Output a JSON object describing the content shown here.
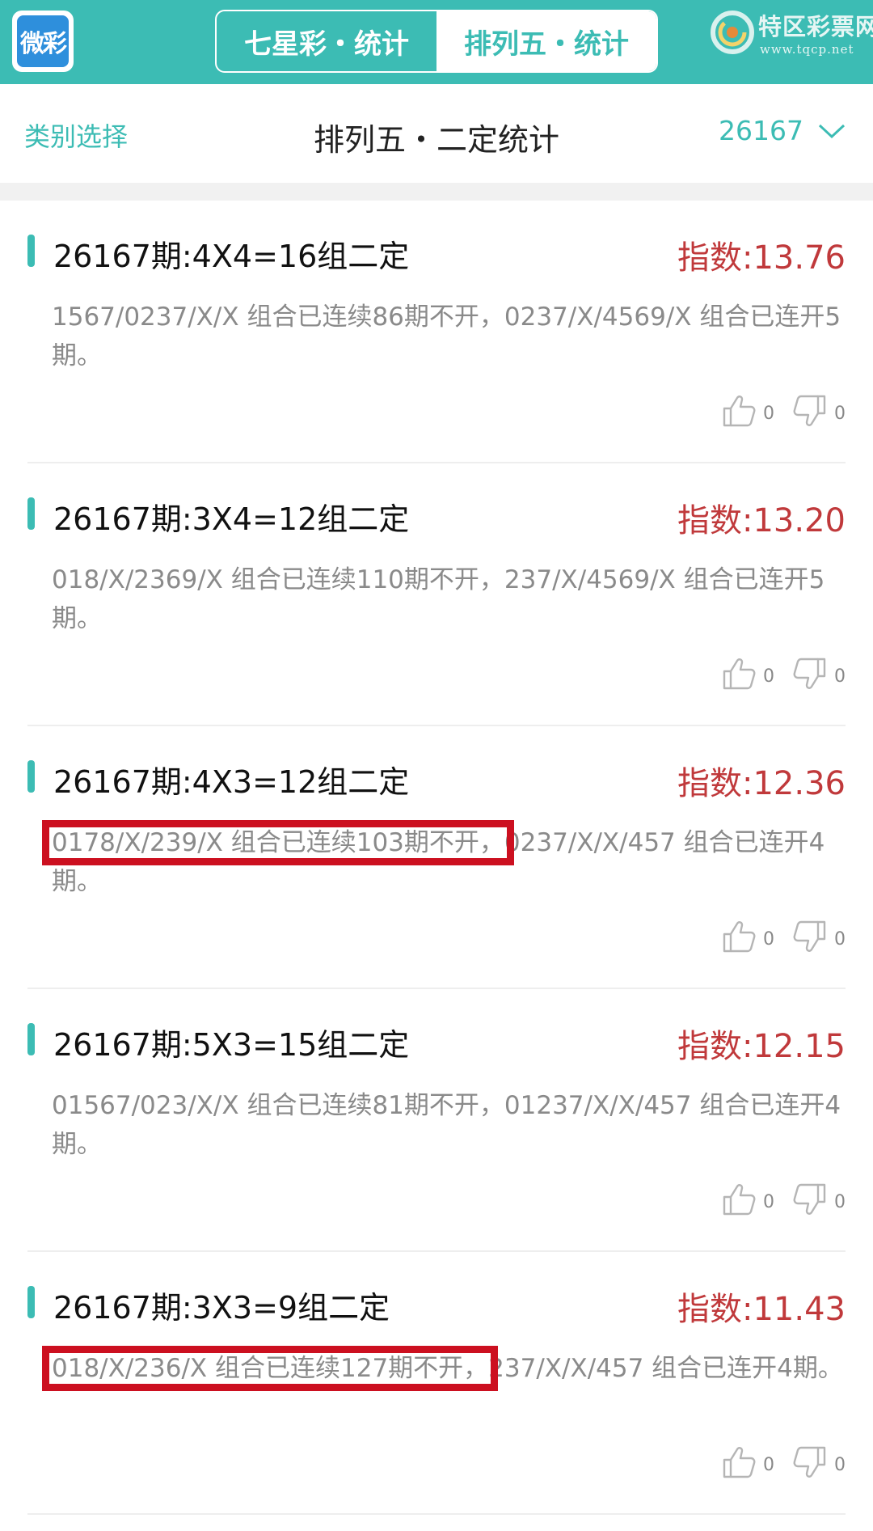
{
  "header": {
    "logo_text": "微彩",
    "tabs": [
      {
        "label": "七星彩・统计",
        "active": false
      },
      {
        "label": "排列五・统计",
        "active": true
      }
    ],
    "brand_name": "特区彩票网",
    "brand_url": "www.tqcp.net"
  },
  "subheader": {
    "category_label": "类别选择",
    "title": "排列五・二定统计",
    "issue": "26167"
  },
  "colors": {
    "accent": "#3cbcb4",
    "index_red": "#c0393b",
    "highlight_red": "#cc1020"
  },
  "cards": [
    {
      "title": "26167期:4X4=16组二定",
      "index": "指数:13.76",
      "desc_a": "1567/0237/X/X 组合已连续86期不开，",
      "desc_b": "0237/X/4569/X 组合已连开5期。",
      "highlighted": false,
      "likes": "0",
      "dislikes": "0"
    },
    {
      "title": "26167期:3X4=12组二定",
      "index": "指数:13.20",
      "desc_a": "018/X/2369/X 组合已连续110期不开，",
      "desc_b": "237/X/4569/X 组合已连开5期。",
      "highlighted": false,
      "likes": "0",
      "dislikes": "0"
    },
    {
      "title": "26167期:4X3=12组二定",
      "index": "指数:12.36",
      "desc_a": "0178/X/239/X 组合已连续103期不开，",
      "desc_b": "0237/X/X/457 组合已连开4期。",
      "highlighted": true,
      "likes": "0",
      "dislikes": "0"
    },
    {
      "title": "26167期:5X3=15组二定",
      "index": "指数:12.15",
      "desc_a": "01567/023/X/X 组合已连续81期不开，",
      "desc_b": "01237/X/X/457 组合已连开4期。",
      "highlighted": false,
      "likes": "0",
      "dislikes": "0"
    },
    {
      "title": "26167期:3X3=9组二定",
      "index": "指数:11.43",
      "desc_a": "018/X/236/X 组合已连续127期不开，",
      "desc_b": "237/X/X/457 组合已连开4期。",
      "highlighted": true,
      "likes": "0",
      "dislikes": "0"
    }
  ]
}
